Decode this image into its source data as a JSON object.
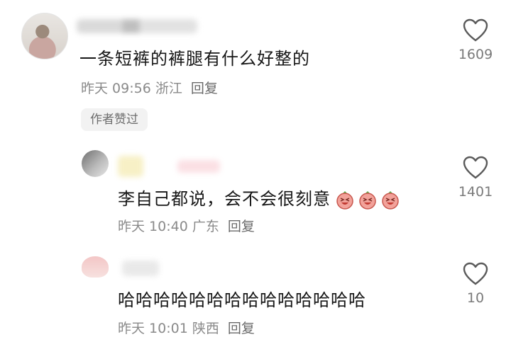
{
  "comments": [
    {
      "text": "一条短裤的裤腿有什么好整的",
      "time": "昨天 09:56",
      "location": "浙江",
      "reply": "回复",
      "badge": "作者赞过",
      "likes": "1609"
    },
    {
      "text": "李自己都说，会不会很刻意",
      "emoji_names": [
        "laughing-face-emoji",
        "laughing-face-emoji",
        "laughing-face-emoji"
      ],
      "time": "昨天 10:40",
      "location": "广东",
      "reply": "回复",
      "likes": "1401"
    },
    {
      "text": "哈哈哈哈哈哈哈哈哈哈哈哈哈哈",
      "time": "昨天 10:01",
      "location": "陕西",
      "reply": "回复",
      "likes": "10"
    }
  ],
  "icons": {
    "like": "heart-outline-icon"
  },
  "colors": {
    "text": "#161616",
    "meta": "#8a8a8a",
    "badge_bg": "#f2f2f2"
  }
}
